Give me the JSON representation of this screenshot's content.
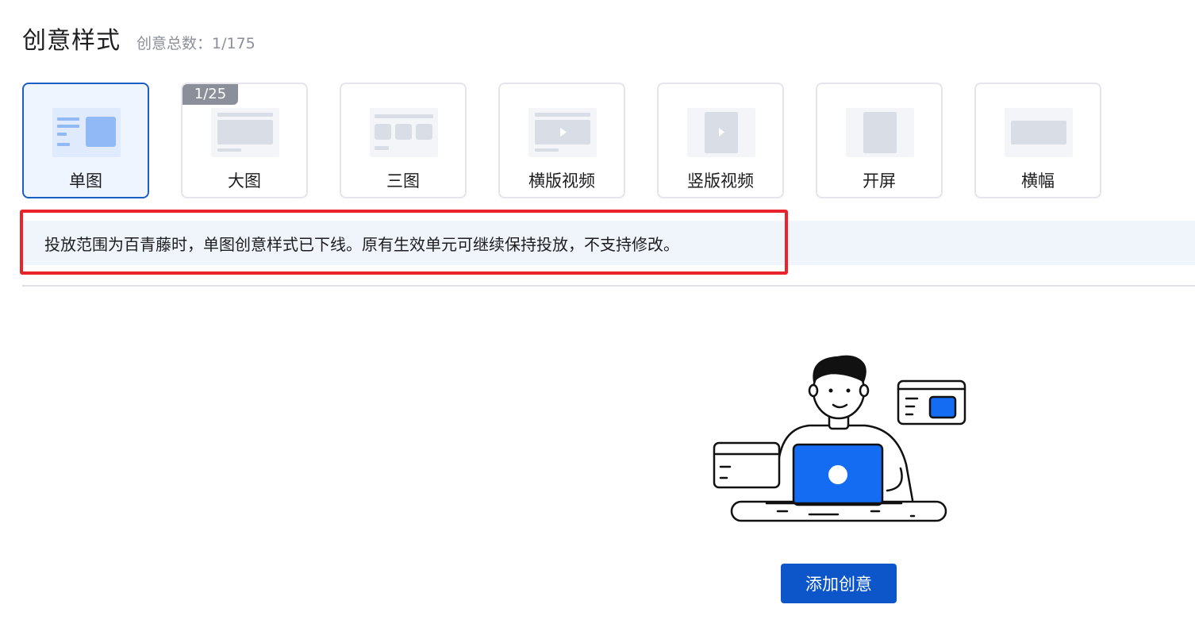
{
  "header": {
    "title": "创意样式",
    "count_text": "创意总数：1/175"
  },
  "cards": [
    {
      "label": "单图",
      "icon": "single-image-icon",
      "selected": true
    },
    {
      "label": "大图",
      "icon": "large-image-icon",
      "badge": "1/25"
    },
    {
      "label": "三图",
      "icon": "three-image-icon"
    },
    {
      "label": "横版视频",
      "icon": "horizontal-video-icon"
    },
    {
      "label": "竖版视频",
      "icon": "vertical-video-icon"
    },
    {
      "label": "开屏",
      "icon": "splash-screen-icon"
    },
    {
      "label": "横幅",
      "icon": "banner-icon"
    }
  ],
  "notice": {
    "text": "投放范围为百青藤时，单图创意样式已下线。原有生效单元可继续保持投放，不支持修改。"
  },
  "empty_state": {
    "illustration": "person-at-laptop-illustration",
    "button_label": "添加创意"
  },
  "colors": {
    "primary": "#0d56c9",
    "selected_border": "#1c5fc4",
    "highlight_border": "#e8232c",
    "notice_bg": "#f0f4fb",
    "thumb_gray": "#d9dde6",
    "thumb_blue": "#91b9f6"
  }
}
